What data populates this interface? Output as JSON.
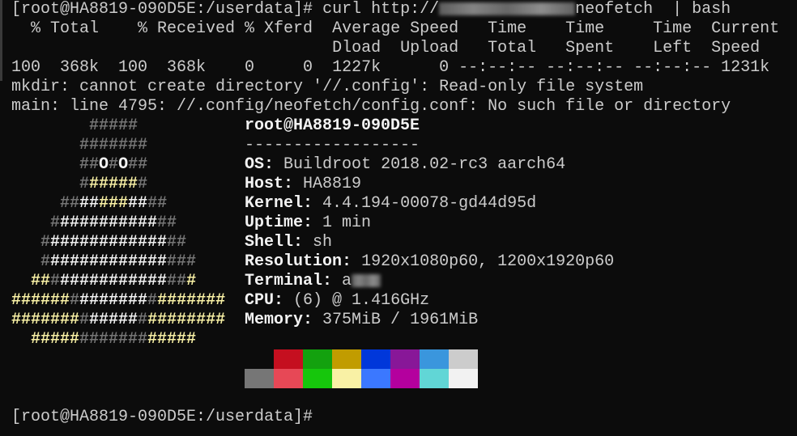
{
  "terminal": {
    "prompt": "[root@HA8819-090D5E:/userdata]#",
    "command_pre": " curl http://",
    "command_post": "neofetch  | bash",
    "curl_header1": "  % Total    % Received % Xferd  Average Speed   Time    Time     Time  Current",
    "curl_header2": "                                 Dload  Upload   Total   Spent    Left  Speed",
    "curl_progress": "100  368k  100  368k    0     0  1227k      0 --:--:-- --:--:-- --:--:-- 1231k",
    "error1": "mkdir: cannot create directory '//.config': Read-only file system",
    "error2": "main: line 4795: //.config/neofetch/config.conf: No such file or directory",
    "final_prompt": "[root@HA8819-090D5E:/userdata]#"
  },
  "colors": {
    "gray": "#767676",
    "white": "#f2f2f2",
    "yellow": "#f9f1a5"
  },
  "tux": [
    [
      [
        "gray",
        "        #####"
      ]
    ],
    [
      [
        "gray",
        "       #######"
      ]
    ],
    [
      [
        "gray",
        "       ##"
      ],
      [
        "white",
        "O"
      ],
      [
        "gray",
        "#"
      ],
      [
        "white",
        "O"
      ],
      [
        "gray",
        "##"
      ]
    ],
    [
      [
        "gray",
        "       #"
      ],
      [
        "yellow",
        "#####"
      ],
      [
        "gray",
        "#"
      ]
    ],
    [
      [
        "gray",
        "     ##"
      ],
      [
        "white",
        "##"
      ],
      [
        "yellow",
        "###"
      ],
      [
        "white",
        "##"
      ],
      [
        "gray",
        "##"
      ]
    ],
    [
      [
        "gray",
        "    #"
      ],
      [
        "white",
        "##########"
      ],
      [
        "gray",
        "##"
      ]
    ],
    [
      [
        "gray",
        "   #"
      ],
      [
        "white",
        "############"
      ],
      [
        "gray",
        "##"
      ]
    ],
    [
      [
        "gray",
        "   #"
      ],
      [
        "white",
        "############"
      ],
      [
        "gray",
        "###"
      ]
    ],
    [
      [
        "yellow",
        "  ##"
      ],
      [
        "gray",
        "#"
      ],
      [
        "white",
        "###########"
      ],
      [
        "gray",
        "##"
      ],
      [
        "yellow",
        "#"
      ]
    ],
    [
      [
        "yellow",
        "######"
      ],
      [
        "gray",
        "#"
      ],
      [
        "white",
        "#######"
      ],
      [
        "gray",
        "#"
      ],
      [
        "yellow",
        "#######"
      ]
    ],
    [
      [
        "yellow",
        "#######"
      ],
      [
        "gray",
        "#"
      ],
      [
        "white",
        "#####"
      ],
      [
        "gray",
        "#"
      ],
      [
        "yellow",
        "########"
      ]
    ],
    [
      [
        "yellow",
        "  #####"
      ],
      [
        "gray",
        "#######"
      ],
      [
        "yellow",
        "#####"
      ]
    ]
  ],
  "info": {
    "title": "root@HA8819-090D5E",
    "separator": "------------------",
    "fields": [
      {
        "label": "OS",
        "value": "Buildroot 2018.02-rc3 aarch64"
      },
      {
        "label": "Host",
        "value": "HA8819"
      },
      {
        "label": "Kernel",
        "value": "4.4.194-00078-gd44d95d"
      },
      {
        "label": "Uptime",
        "value": "1 min"
      },
      {
        "label": "Shell",
        "value": "sh"
      },
      {
        "label": "Resolution",
        "value": "1920x1080p60, 1200x1920p60"
      },
      {
        "label": "Terminal",
        "value": "a"
      },
      {
        "label": "CPU",
        "value": "(6) @ 1.416GHz"
      },
      {
        "label": "Memory",
        "value": "375MiB / 1961MiB"
      }
    ]
  },
  "palette": {
    "normal": [
      "#0c0c0c",
      "#c50f1f",
      "#13a10e",
      "#c19c00",
      "#0037da",
      "#881798",
      "#3a96dd",
      "#cccccc"
    ],
    "bright": [
      "#767676",
      "#e74856",
      "#16c60c",
      "#f9f1a5",
      "#3b78ff",
      "#b4009e",
      "#61d6d6",
      "#f2f2f2"
    ]
  }
}
